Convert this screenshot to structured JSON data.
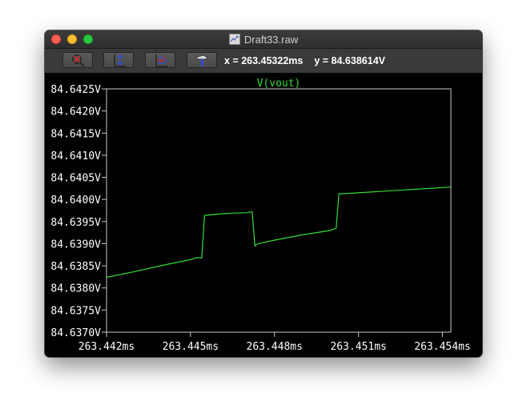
{
  "window": {
    "title": "Draft33.raw"
  },
  "toolbar": {
    "tools": [
      "zoom-out-icon",
      "autorange-y-icon",
      "zoom-fit-icon",
      "hammer-icon"
    ],
    "cursor_x": "x = 263.45322ms",
    "cursor_y": "y = 84.638614V"
  },
  "colors": {
    "trace": "#33dd33",
    "axes": "#c8c8c8",
    "background": "#000000"
  },
  "chart_data": {
    "type": "line",
    "title": "V(vout)",
    "series": [
      {
        "name": "V(vout)",
        "color": "#33dd33",
        "x": [
          263.442,
          263.443,
          263.444,
          263.445,
          263.4452,
          263.4454,
          263.4455,
          263.446,
          263.4465,
          263.447,
          263.4472,
          263.4473,
          263.4474,
          263.448,
          263.449,
          263.45,
          263.4502,
          263.4503,
          263.4505,
          263.451,
          263.452,
          263.453,
          263.4543
        ],
        "y": [
          84.63824,
          84.63837,
          84.63851,
          84.63864,
          84.63868,
          84.63868,
          84.63964,
          84.63967,
          84.63969,
          84.6397,
          84.63972,
          84.63895,
          84.639,
          84.63908,
          84.6392,
          84.6393,
          84.63935,
          84.64013,
          84.64013,
          84.64015,
          84.64019,
          84.64023,
          84.64028
        ]
      }
    ],
    "xlim": [
      263.442,
      263.4543
    ],
    "ylim": [
      84.637,
      84.6425
    ],
    "x_ticks": [
      263.442,
      263.445,
      263.448,
      263.451,
      263.454
    ],
    "x_tick_labels": [
      "263.442ms",
      "263.445ms",
      "263.448ms",
      "263.451ms",
      "263.454ms"
    ],
    "y_ticks": [
      84.637,
      84.6375,
      84.638,
      84.6385,
      84.639,
      84.6395,
      84.64,
      84.6405,
      84.641,
      84.6415,
      84.642,
      84.6425
    ],
    "y_tick_labels": [
      "84.6370V",
      "84.6375V",
      "84.6380V",
      "84.6385V",
      "84.6390V",
      "84.6395V",
      "84.6400V",
      "84.6405V",
      "84.6410V",
      "84.6415V",
      "84.6420V",
      "84.6425V"
    ],
    "grid": false
  }
}
